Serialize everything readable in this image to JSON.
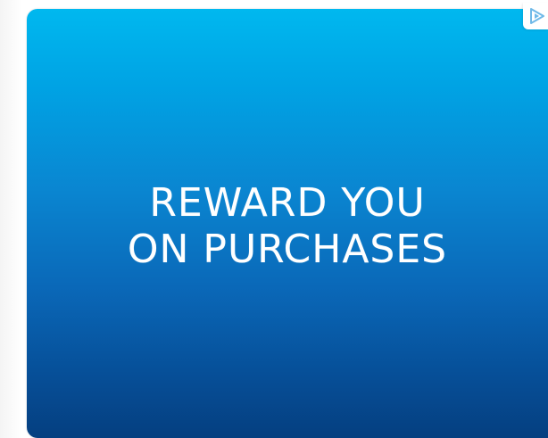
{
  "ad": {
    "headline_line1": "REWARD YOU",
    "headline_line2": "ON PURCHASES",
    "background_top": "#00b8ef",
    "background_bottom": "#053f80",
    "text_color": "#ffffff"
  },
  "adchoices": {
    "icon": "adchoices-icon",
    "color": "#6fb9e8"
  }
}
